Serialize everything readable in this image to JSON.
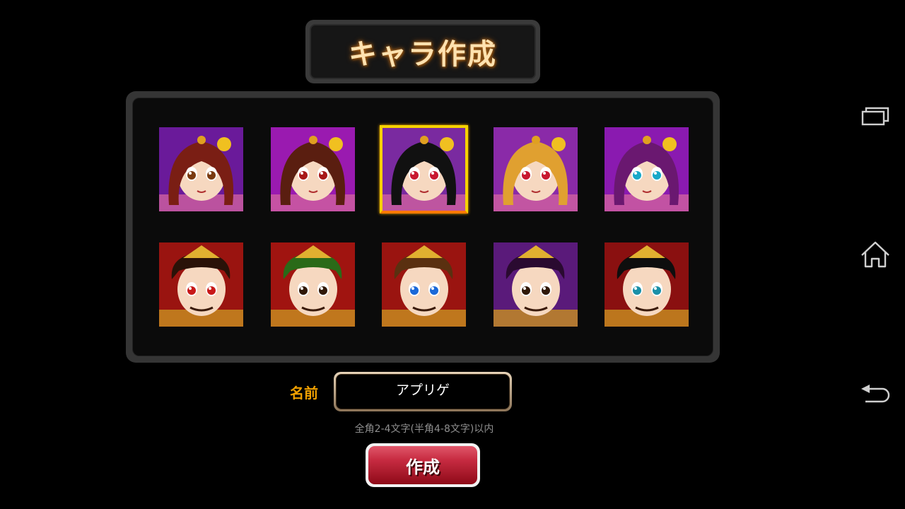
{
  "title": "キャラ作成",
  "characters": [
    {
      "icon": "heroine-red-hair-portrait",
      "bg": "#6a1a9a",
      "hair": "#7a1e14",
      "eye": "#7a3a10",
      "selected": false
    },
    {
      "icon": "heroine-flower-crown-portrait",
      "bg": "#9a1ab0",
      "hair": "#5a1e10",
      "eye": "#a81818",
      "selected": false
    },
    {
      "icon": "heroine-black-hair-portrait",
      "bg": "#7a2aa0",
      "hair": "#111111",
      "eye": "#c81830",
      "selected": true
    },
    {
      "icon": "heroine-blonde-portrait",
      "bg": "#8a2aa8",
      "hair": "#e0a030",
      "eye": "#c81830",
      "selected": false
    },
    {
      "icon": "heroine-purple-hair-portrait",
      "bg": "#8a1ab0",
      "hair": "#6a1870",
      "eye": "#18a8c8",
      "selected": false
    },
    {
      "icon": "warrior-wild-hair-portrait",
      "bg": "#9a1410",
      "hair": "#2a1208",
      "eye": "#c81818",
      "selected": false
    },
    {
      "icon": "warrior-green-helmet-portrait",
      "bg": "#a01410",
      "hair": "#2a6a18",
      "eye": "#301808",
      "selected": false
    },
    {
      "icon": "emperor-gold-crown-portrait",
      "bg": "#9a1410",
      "hair": "#5a3010",
      "eye": "#1a68d8",
      "selected": false
    },
    {
      "icon": "warlord-purple-portrait",
      "bg": "#5a1a7a",
      "hair": "#2a0a30",
      "eye": "#301808",
      "selected": false
    },
    {
      "icon": "strategist-long-hair-portrait",
      "bg": "#8a1010",
      "hair": "#0e0e0e",
      "eye": "#1a90a8",
      "selected": false
    }
  ],
  "form": {
    "name_label": "名前",
    "name_value": "アプリゲ",
    "hint": "全角2-4文字(半角4-8文字)以内",
    "create_label": "作成"
  },
  "system_nav": {
    "recent": "recent-apps-icon",
    "home": "home-icon",
    "back": "back-icon"
  }
}
